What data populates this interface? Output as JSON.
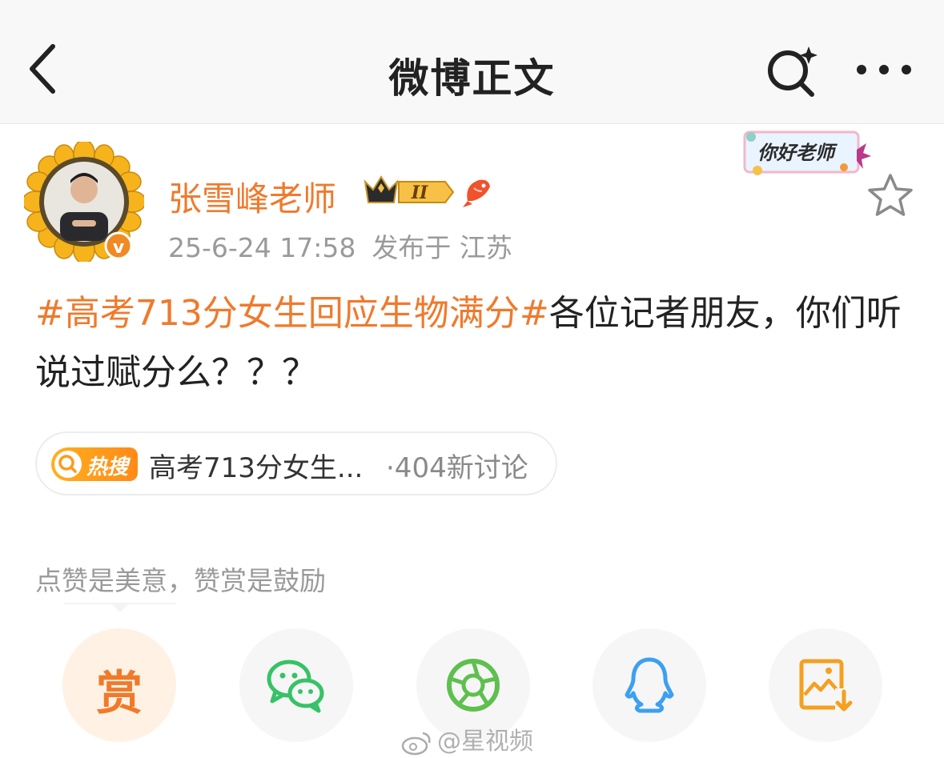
{
  "nav": {
    "title": "微博正文",
    "back_icon": "chevron-left-icon",
    "search_icon": "sparkle-search-icon",
    "more_icon": "more-dots-icon"
  },
  "post": {
    "author": "张雪峰老师",
    "member_level": "II",
    "timestamp": "25-6-24 17:58",
    "location": "发布于 江苏",
    "sticker_text": "你好老师",
    "topic": "#高考713分女生回应生物满分#",
    "body": "各位记者朋友，你们听说过赋分么？？？"
  },
  "hot_search": {
    "tag": "热搜",
    "title": "高考713分女生...",
    "count": "·404新讨论"
  },
  "reward_hint": "点赞是美意，赞赏是鼓励",
  "share": {
    "reward_label": "赏",
    "items": [
      "wechat-icon",
      "moments-icon",
      "qq-icon",
      "save-image-icon"
    ]
  },
  "watermark": "@星视频",
  "colors": {
    "accent": "#ef7a2d",
    "wechat": "#37c267",
    "moments": "#5fbf4f",
    "qq": "#3ca0f0",
    "save": "#f4a020"
  }
}
